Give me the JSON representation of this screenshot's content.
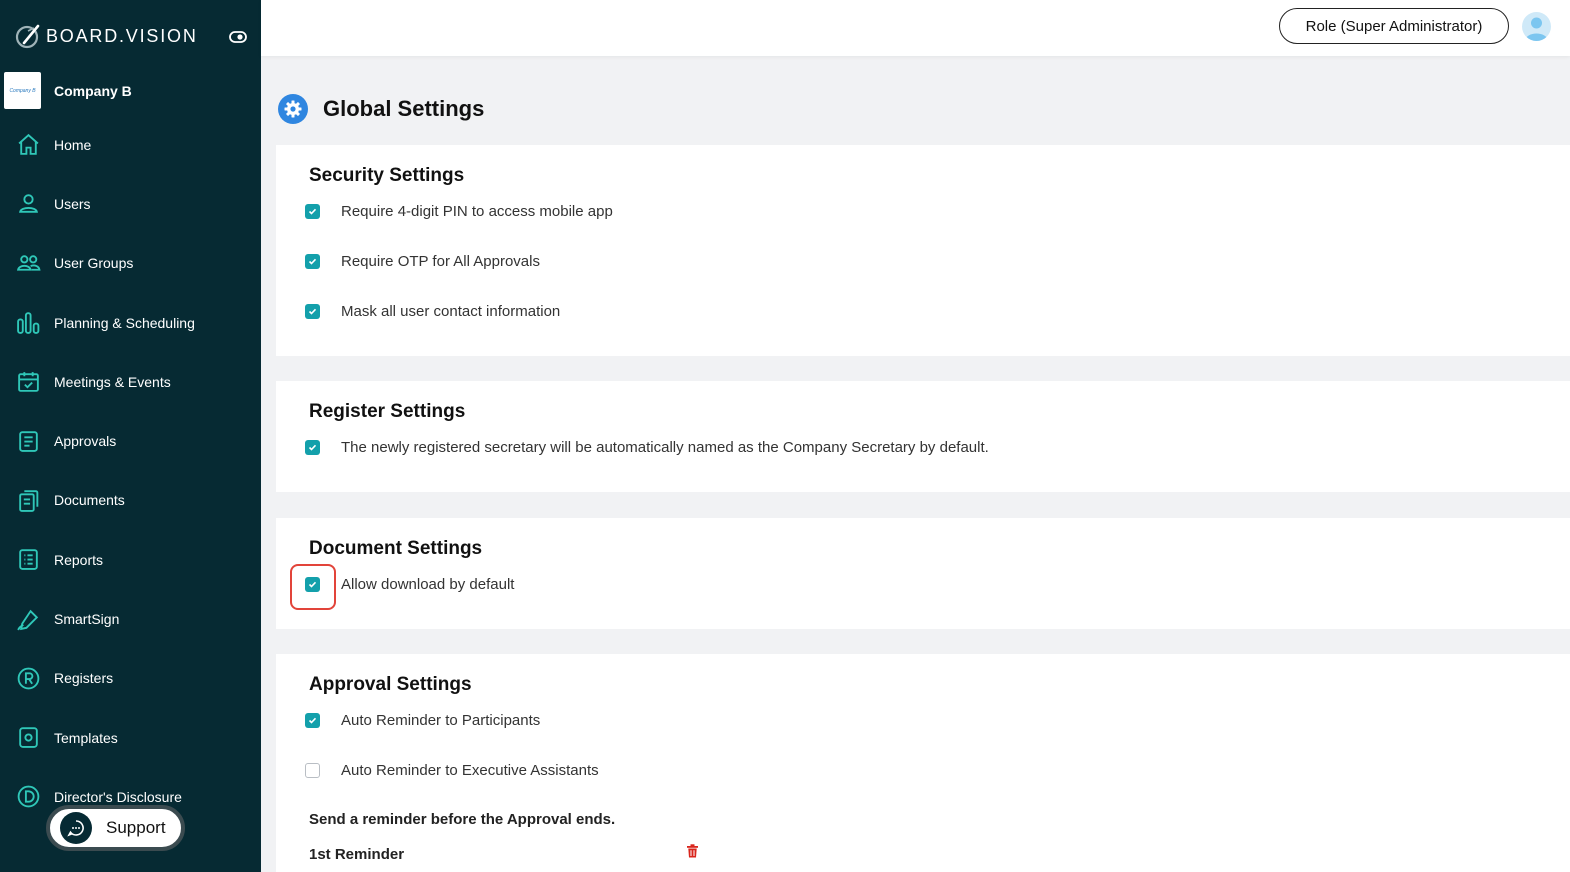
{
  "brand": {
    "name": "BOARD.VISION"
  },
  "company": {
    "name": "Company B",
    "logo_text": "Company B"
  },
  "nav": [
    {
      "label": "Home",
      "icon": "home-icon"
    },
    {
      "label": "Users",
      "icon": "user-icon"
    },
    {
      "label": "User Groups",
      "icon": "users-icon"
    },
    {
      "label": "Planning & Scheduling",
      "icon": "planning-icon"
    },
    {
      "label": "Meetings & Events",
      "icon": "calendar-icon"
    },
    {
      "label": "Approvals",
      "icon": "approvals-icon"
    },
    {
      "label": "Documents",
      "icon": "documents-icon"
    },
    {
      "label": "Reports",
      "icon": "reports-icon"
    },
    {
      "label": "SmartSign",
      "icon": "pen-icon"
    },
    {
      "label": "Registers",
      "icon": "registers-icon"
    },
    {
      "label": "Templates",
      "icon": "templates-icon"
    },
    {
      "label": "Director's Disclosure",
      "icon": "disclosure-icon"
    }
  ],
  "support": {
    "label": "Support"
  },
  "topbar": {
    "role_label": "Role (Super Administrator)"
  },
  "page": {
    "title": "Global Settings"
  },
  "sections": {
    "security": {
      "title": "Security Settings",
      "options": [
        {
          "label": "Require 4-digit PIN to access mobile app",
          "checked": true
        },
        {
          "label": "Require OTP for All Approvals",
          "checked": true
        },
        {
          "label": "Mask all user contact information",
          "checked": true
        }
      ]
    },
    "register": {
      "title": "Register Settings",
      "options": [
        {
          "label": "The newly registered secretary will be automatically named as the Company Secretary by default.",
          "checked": true
        }
      ]
    },
    "document": {
      "title": "Document Settings",
      "options": [
        {
          "label": "Allow download by default",
          "checked": true
        }
      ]
    },
    "approval": {
      "title": "Approval Settings",
      "options": [
        {
          "label": "Auto Reminder to Participants",
          "checked": true
        },
        {
          "label": "Auto Reminder to Executive Assistants",
          "checked": false
        }
      ],
      "reminder_heading": "Send a reminder before the Approval ends.",
      "first_reminder_label": "1st Reminder"
    }
  },
  "colors": {
    "sidebar": "#062a33",
    "checkbox_on": "#13a0ab",
    "highlight": "#e2443a",
    "gear_badge": "#2f86e0",
    "trash": "#d9251c"
  }
}
